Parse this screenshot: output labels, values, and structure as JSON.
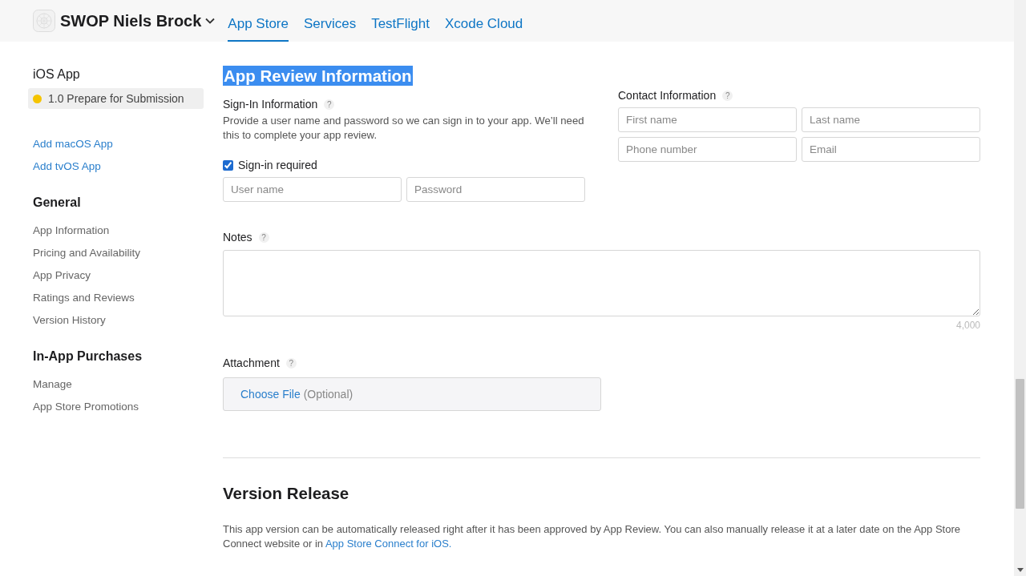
{
  "header": {
    "account": "SWOP Niels Brock",
    "tabs": [
      {
        "label": "App Store",
        "selected": true
      },
      {
        "label": "Services",
        "selected": false
      },
      {
        "label": "TestFlight",
        "selected": false
      },
      {
        "label": "Xcode Cloud",
        "selected": false
      }
    ]
  },
  "sidebar": {
    "platform": {
      "title": "iOS App",
      "versions": [
        {
          "label": "1.0 Prepare for Submission",
          "color": "#f5c400",
          "selected": true
        }
      ]
    },
    "add_links": [
      "Add macOS App",
      "Add tvOS App"
    ],
    "sections": [
      {
        "title": "General",
        "items": [
          "App Information",
          "Pricing and Availability",
          "App Privacy",
          "Ratings and Reviews",
          "Version History"
        ]
      },
      {
        "title": "In-App Purchases",
        "items": [
          "Manage",
          "App Store Promotions"
        ]
      }
    ]
  },
  "review": {
    "title": "App Review Information",
    "highlighted": true,
    "sign_in": {
      "label": "Sign-In Information",
      "help": "?",
      "description": "Provide a user name and password so we can sign in to your app. We’ll need this to complete your app review.",
      "required": {
        "label": "Sign-in required",
        "checked": true
      },
      "fields": [
        {
          "placeholder": "User name"
        },
        {
          "placeholder": "Password"
        }
      ]
    },
    "contact": {
      "label": "Contact Information",
      "help": "?",
      "fields": [
        {
          "placeholder": "First name"
        },
        {
          "placeholder": "Last name"
        },
        {
          "placeholder": "Phone number"
        },
        {
          "placeholder": "Email"
        }
      ]
    },
    "notes": {
      "label": "Notes",
      "help": "?",
      "counter": "4,000"
    },
    "attachment": {
      "label": "Attachment",
      "help": "?",
      "button": "Choose File",
      "hint": "(Optional)"
    }
  },
  "version_release": {
    "title": "Version Release",
    "text": "This app version can be automatically released right after it has been approved by App Review. You can also manually release it at a later date on the App Store Connect website or in ",
    "link": "App Store Connect for iOS."
  }
}
